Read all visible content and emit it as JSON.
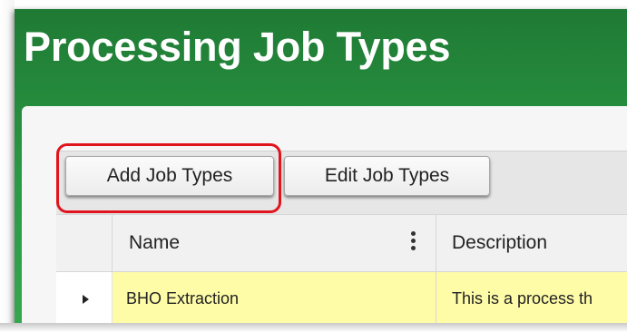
{
  "page": {
    "title": "Processing Job Types"
  },
  "toolbar": {
    "add_label": "Add Job Types",
    "edit_label": "Edit Job Types"
  },
  "grid": {
    "columns": [
      "Name",
      "Description"
    ],
    "rows": [
      {
        "name": "BHO Extraction",
        "description": "This is a process th"
      }
    ]
  },
  "icons": {
    "column_menu": "kebab-icon",
    "row_expander": "triangle-right-icon"
  },
  "colors": {
    "header_green": "#2b9a45",
    "highlight_red": "#e0141c",
    "row_highlight": "#fffca8"
  }
}
